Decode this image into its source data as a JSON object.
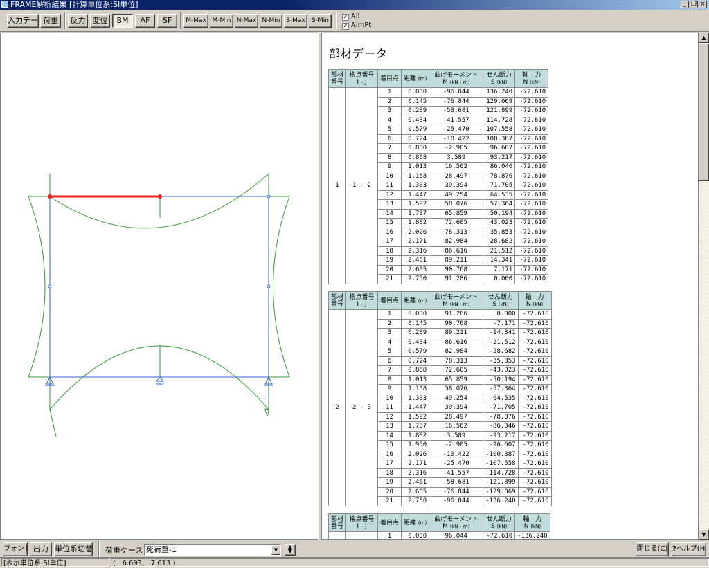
{
  "window": {
    "title": "FRAME解析結果 [計算単位系:SI単位]",
    "controls": [
      "_",
      "❐",
      "×"
    ]
  },
  "toolbar": {
    "buttons": [
      "入力データ",
      "荷重",
      "反力",
      "変位",
      "BM",
      "AF",
      "SF",
      "M-Max",
      "M-Min",
      "N-Max",
      "N-Min",
      "S-Max",
      "S-Min"
    ],
    "pressed": "BM",
    "checkboxes": [
      {
        "label": "All",
        "checked": true
      },
      {
        "label": "AimPt",
        "checked": true
      }
    ]
  },
  "diagram": {
    "frame_color": "#3366cc",
    "moment_color": "#339933",
    "highlight_color": "#ee2222"
  },
  "panel": {
    "title": "部材データ",
    "headers": [
      {
        "l1": "部材",
        "l2": "番号"
      },
      {
        "l1": "格点番号",
        "l2": "I - J"
      },
      {
        "l1": "着目点",
        "l2": ""
      },
      {
        "l1": "距離",
        "u1": "(m)",
        "l2": ""
      },
      {
        "l1": "曲げモーメント",
        "l2": "M",
        "u2": "(kN・m)"
      },
      {
        "l1": "せん断力",
        "l2": "S",
        "u2": "(kN)"
      },
      {
        "l1": "軸　力",
        "l2": "N",
        "u2": "(kN)"
      }
    ],
    "members": [
      {
        "no": "1",
        "ij": "1 - 2",
        "rows": [
          [
            "1",
            "0.000",
            "-96.044",
            "136.240",
            "-72.610"
          ],
          [
            "2",
            "0.145",
            "-76.844",
            "129.069",
            "-72.610"
          ],
          [
            "3",
            "0.289",
            "-58.681",
            "121.899",
            "-72.610"
          ],
          [
            "4",
            "0.434",
            "-41.557",
            "114.728",
            "-72.610"
          ],
          [
            "5",
            "0.579",
            "-25.470",
            "107.558",
            "-72.610"
          ],
          [
            "6",
            "0.724",
            "-10.422",
            "100.387",
            "-72.610"
          ],
          [
            "7",
            "0.800",
            "-2.905",
            "96.607",
            "-72.610"
          ],
          [
            "8",
            "0.868",
            "3.589",
            "93.217",
            "-72.610"
          ],
          [
            "9",
            "1.013",
            "16.562",
            "86.046",
            "-72.610"
          ],
          [
            "10",
            "1.158",
            "28.497",
            "78.876",
            "-72.610"
          ],
          [
            "11",
            "1.303",
            "39.394",
            "71.705",
            "-72.610"
          ],
          [
            "12",
            "1.447",
            "49.254",
            "64.535",
            "-72.610"
          ],
          [
            "13",
            "1.592",
            "58.076",
            "57.364",
            "-72.610"
          ],
          [
            "14",
            "1.737",
            "65.859",
            "50.194",
            "-72.610"
          ],
          [
            "15",
            "1.882",
            "72.605",
            "43.023",
            "-72.610"
          ],
          [
            "16",
            "2.026",
            "78.313",
            "35.853",
            "-72.610"
          ],
          [
            "17",
            "2.171",
            "82.984",
            "28.682",
            "-72.610"
          ],
          [
            "18",
            "2.316",
            "86.616",
            "21.512",
            "-72.610"
          ],
          [
            "19",
            "2.461",
            "89.211",
            "14.341",
            "-72.610"
          ],
          [
            "20",
            "2.605",
            "90.768",
            "7.171",
            "-72.610"
          ],
          [
            "21",
            "2.750",
            "91.286",
            "0.000",
            "-72.610"
          ]
        ]
      },
      {
        "no": "2",
        "ij": "2 - 3",
        "rows": [
          [
            "1",
            "0.000",
            "91.286",
            "0.000",
            "-72.610"
          ],
          [
            "2",
            "0.145",
            "90.768",
            "-7.171",
            "-72.610"
          ],
          [
            "3",
            "0.289",
            "89.211",
            "-14.341",
            "-72.610"
          ],
          [
            "4",
            "0.434",
            "86.616",
            "-21.512",
            "-72.610"
          ],
          [
            "5",
            "0.579",
            "82.984",
            "-28.682",
            "-72.610"
          ],
          [
            "6",
            "0.724",
            "78.313",
            "-35.853",
            "-72.610"
          ],
          [
            "7",
            "0.868",
            "72.605",
            "-43.023",
            "-72.610"
          ],
          [
            "8",
            "1.013",
            "65.859",
            "-50.194",
            "-72.610"
          ],
          [
            "9",
            "1.158",
            "58.076",
            "-57.364",
            "-72.610"
          ],
          [
            "10",
            "1.303",
            "49.254",
            "-64.535",
            "-72.610"
          ],
          [
            "11",
            "1.447",
            "39.394",
            "-71.705",
            "-72.610"
          ],
          [
            "12",
            "1.592",
            "28.497",
            "-78.876",
            "-72.610"
          ],
          [
            "13",
            "1.737",
            "16.562",
            "-86.046",
            "-72.610"
          ],
          [
            "14",
            "1.882",
            "3.589",
            "-93.217",
            "-72.610"
          ],
          [
            "15",
            "1.950",
            "-2.905",
            "-96.607",
            "-72.610"
          ],
          [
            "16",
            "2.026",
            "-10.422",
            "-100.387",
            "-72.610"
          ],
          [
            "17",
            "2.171",
            "-25.470",
            "-107.558",
            "-72.610"
          ],
          [
            "18",
            "2.316",
            "-41.557",
            "-114.728",
            "-72.610"
          ],
          [
            "19",
            "2.461",
            "-58.681",
            "-121.899",
            "-72.610"
          ],
          [
            "20",
            "2.605",
            "-76.844",
            "-129.069",
            "-72.610"
          ],
          [
            "21",
            "2.750",
            "-96.044",
            "-136.240",
            "-72.610"
          ]
        ]
      },
      {
        "no": "",
        "ij": "",
        "rows": [
          [
            "1",
            "0.000",
            "96.044",
            "-72.610",
            "-136.240"
          ]
        ]
      }
    ]
  },
  "bottom": {
    "buttons": [
      "フォント",
      "出力",
      "単位系切替"
    ],
    "loadcase_label": "荷重ケース",
    "loadcase_value": "死荷重-1",
    "close_label": "閉じる(C)",
    "help_label": "ヘルプ(H)"
  },
  "status": {
    "units": "[表示単位系:SI単位]",
    "coords": "(   6.693,   7.613 )"
  }
}
